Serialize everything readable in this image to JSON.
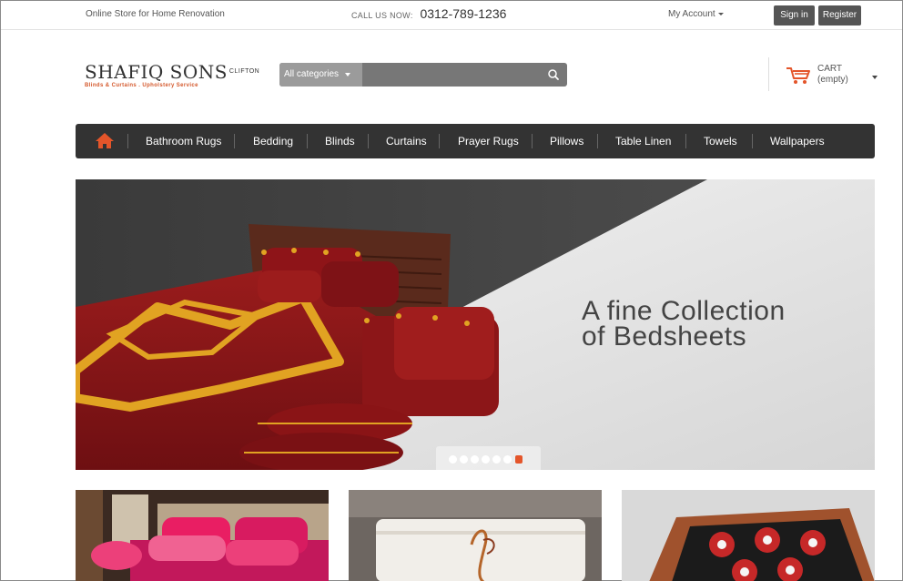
{
  "topbar": {
    "tagline": "Online Store for Home Renovation",
    "call_label": "CALL US NOW:",
    "phone": "0312-789-1236",
    "account_label": "My Account",
    "signin_label": "Sign in",
    "register_label": "Register"
  },
  "logo": {
    "name": "SHAFIQ SONS",
    "name_suffix": "CLIFTON",
    "tagline": "Blinds & Curtains . Upholstery Service"
  },
  "search": {
    "category_label": "All categories",
    "query": "",
    "placeholder": ""
  },
  "cart": {
    "title": "CART",
    "status": "(empty)"
  },
  "nav": {
    "items": [
      {
        "label": "Bathroom Rugs"
      },
      {
        "label": "Bedding"
      },
      {
        "label": "Blinds"
      },
      {
        "label": "Curtains"
      },
      {
        "label": "Prayer Rugs"
      },
      {
        "label": "Pillows"
      },
      {
        "label": "Table Linen"
      },
      {
        "label": "Towels"
      },
      {
        "label": "Wallpapers"
      }
    ]
  },
  "hero": {
    "caption_line1": "A fine Collection",
    "caption_line2": "of Bedsheets",
    "slide_count": 7,
    "active_slide": 7
  },
  "icons": {
    "home": "home-icon",
    "search": "search-icon",
    "cart": "cart-icon"
  },
  "colors": {
    "accent": "#e4552a",
    "nav_bg": "#333333"
  }
}
